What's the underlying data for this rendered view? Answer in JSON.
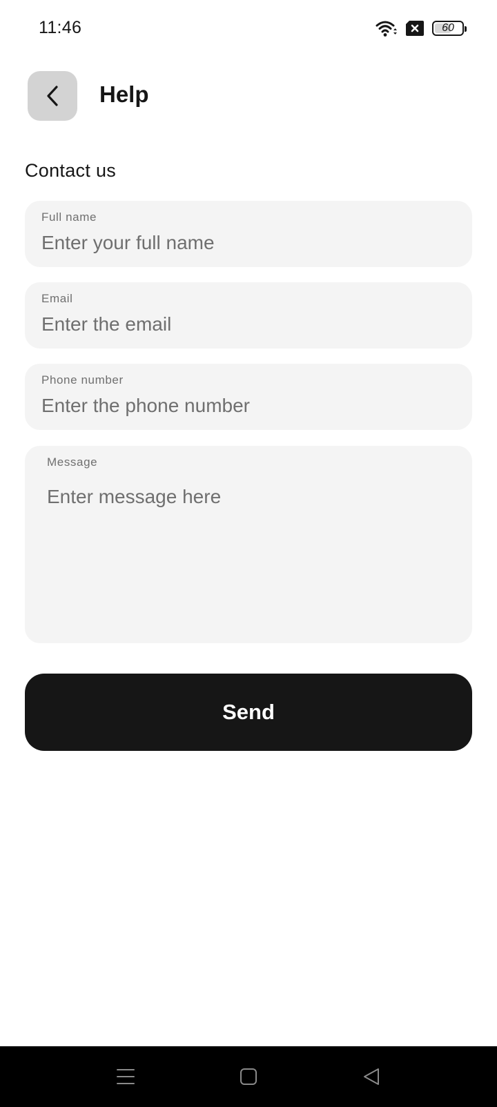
{
  "status_bar": {
    "time": "11:46",
    "battery_level": "60",
    "battery_fraction": 0.6,
    "icons": [
      "wifi-icon",
      "no-sim-icon",
      "battery-icon"
    ]
  },
  "header": {
    "back_icon": "chevron-left-icon",
    "title": "Help"
  },
  "form": {
    "section_title": "Contact us",
    "full_name": {
      "label": "Full name",
      "placeholder": "Enter your full name",
      "value": ""
    },
    "email": {
      "label": "Email",
      "placeholder": "Enter the email",
      "value": ""
    },
    "phone": {
      "label": "Phone number",
      "placeholder": "Enter the phone number",
      "value": ""
    },
    "message": {
      "label": "Message",
      "placeholder": "Enter message here",
      "value": ""
    },
    "send_label": "Send"
  },
  "nav_bar": {
    "icons": [
      "menu-icon",
      "home-icon",
      "back-triangle-icon"
    ]
  },
  "colors": {
    "primary": "#161616",
    "field_bg": "#f4f4f4",
    "back_button_bg": "#d3d3d3",
    "placeholder": "#6f6f6f"
  }
}
